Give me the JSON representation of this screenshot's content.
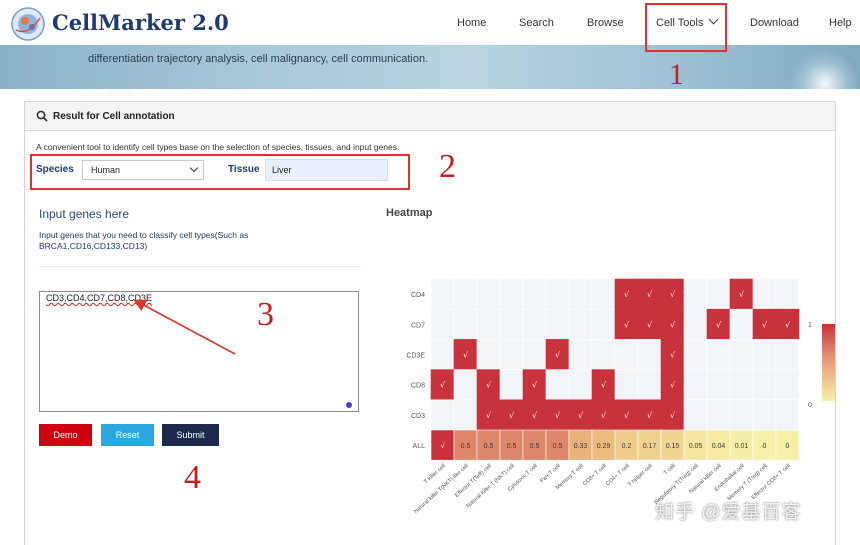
{
  "header": {
    "brand": "CellMarker 2.0",
    "nav": [
      "Home",
      "Search",
      "Browse",
      "Cell Tools",
      "Download",
      "Help"
    ],
    "banner_text": "differentiation trajectory analysis, cell malignancy, cell communication."
  },
  "annotations": [
    "1",
    "2",
    "3",
    "4"
  ],
  "panel": {
    "title": "Result for Cell annotation",
    "description": "A convenient tool to identify cell types base on the selection of species, tissues, and input genes.",
    "species_label": "Species",
    "species_value": "Human",
    "tissue_label": "Tissue",
    "tissue_value": "Liver",
    "input_title": "Input genes here",
    "input_help": "Input genes that you need to classify cell types(Such as BRCA1,CD16,CD133,CD13)",
    "genes_value": "CD3,CD4,CD7,CD8,CD3E",
    "buttons": {
      "demo": "Demo",
      "reset": "Reset",
      "submit": "Submit"
    },
    "heatmap_title": "Heatmap"
  },
  "colors": {
    "demo": "#d0020f",
    "reset": "#29a8e0",
    "submit": "#1b2a4a",
    "accent_red": "#e23030",
    "high": "#c8323a",
    "low": "#f7f0a8",
    "empty": "#f1f4f9"
  },
  "chart_data": {
    "type": "heatmap",
    "rows": [
      "CD4",
      "CD7",
      "CD3E",
      "CD8",
      "CD3"
    ],
    "columns": [
      "T killer cell",
      "Natural killer T(NKT) like cell",
      "Effector T(Teff) cell",
      "Natural killer T (NKT) cell",
      "Cytotoxic T cell",
      "Pan-T cell",
      "Memory T cell",
      "CD8+ T cell",
      "CD4+ T cell",
      "T helper cell",
      "T cell",
      "Regulatory T(Treg) cell",
      "Natural killer cell",
      "Endothelial cell",
      "Memory T (Treg) cell",
      "Effector CD8+ T cell"
    ],
    "matrix": [
      [
        0,
        0,
        0,
        0,
        0,
        0,
        0,
        0,
        1,
        1,
        1,
        0,
        0,
        1,
        0,
        0
      ],
      [
        0,
        0,
        0,
        0,
        0,
        0,
        0,
        0,
        1,
        1,
        1,
        0,
        1,
        0,
        1,
        1
      ],
      [
        0,
        1,
        0,
        0,
        0,
        1,
        0,
        0,
        0,
        0,
        1,
        0,
        0,
        0,
        0,
        0
      ],
      [
        1,
        0,
        1,
        0,
        1,
        0,
        0,
        1,
        0,
        0,
        1,
        0,
        0,
        0,
        0,
        0
      ],
      [
        0,
        0,
        1,
        1,
        1,
        1,
        1,
        1,
        1,
        1,
        1,
        0,
        0,
        0,
        0,
        0
      ]
    ],
    "all_row_label": "ALL",
    "all_values": [
      "√",
      "0.5",
      "0.5",
      "0.5",
      "0.5",
      "0.5",
      "0.33",
      "0.29",
      "0.2",
      "0.17",
      "0.15",
      "0.05",
      "0.04",
      "0.01",
      "0",
      "0"
    ],
    "all_numeric": [
      1,
      0.5,
      0.5,
      0.5,
      0.5,
      0.5,
      0.33,
      0.29,
      0.2,
      0.17,
      0.15,
      0.05,
      0.04,
      0.01,
      0,
      0
    ],
    "mark": "√",
    "scale_ticks": [
      "1",
      "0"
    ],
    "range": [
      0,
      1
    ]
  }
}
